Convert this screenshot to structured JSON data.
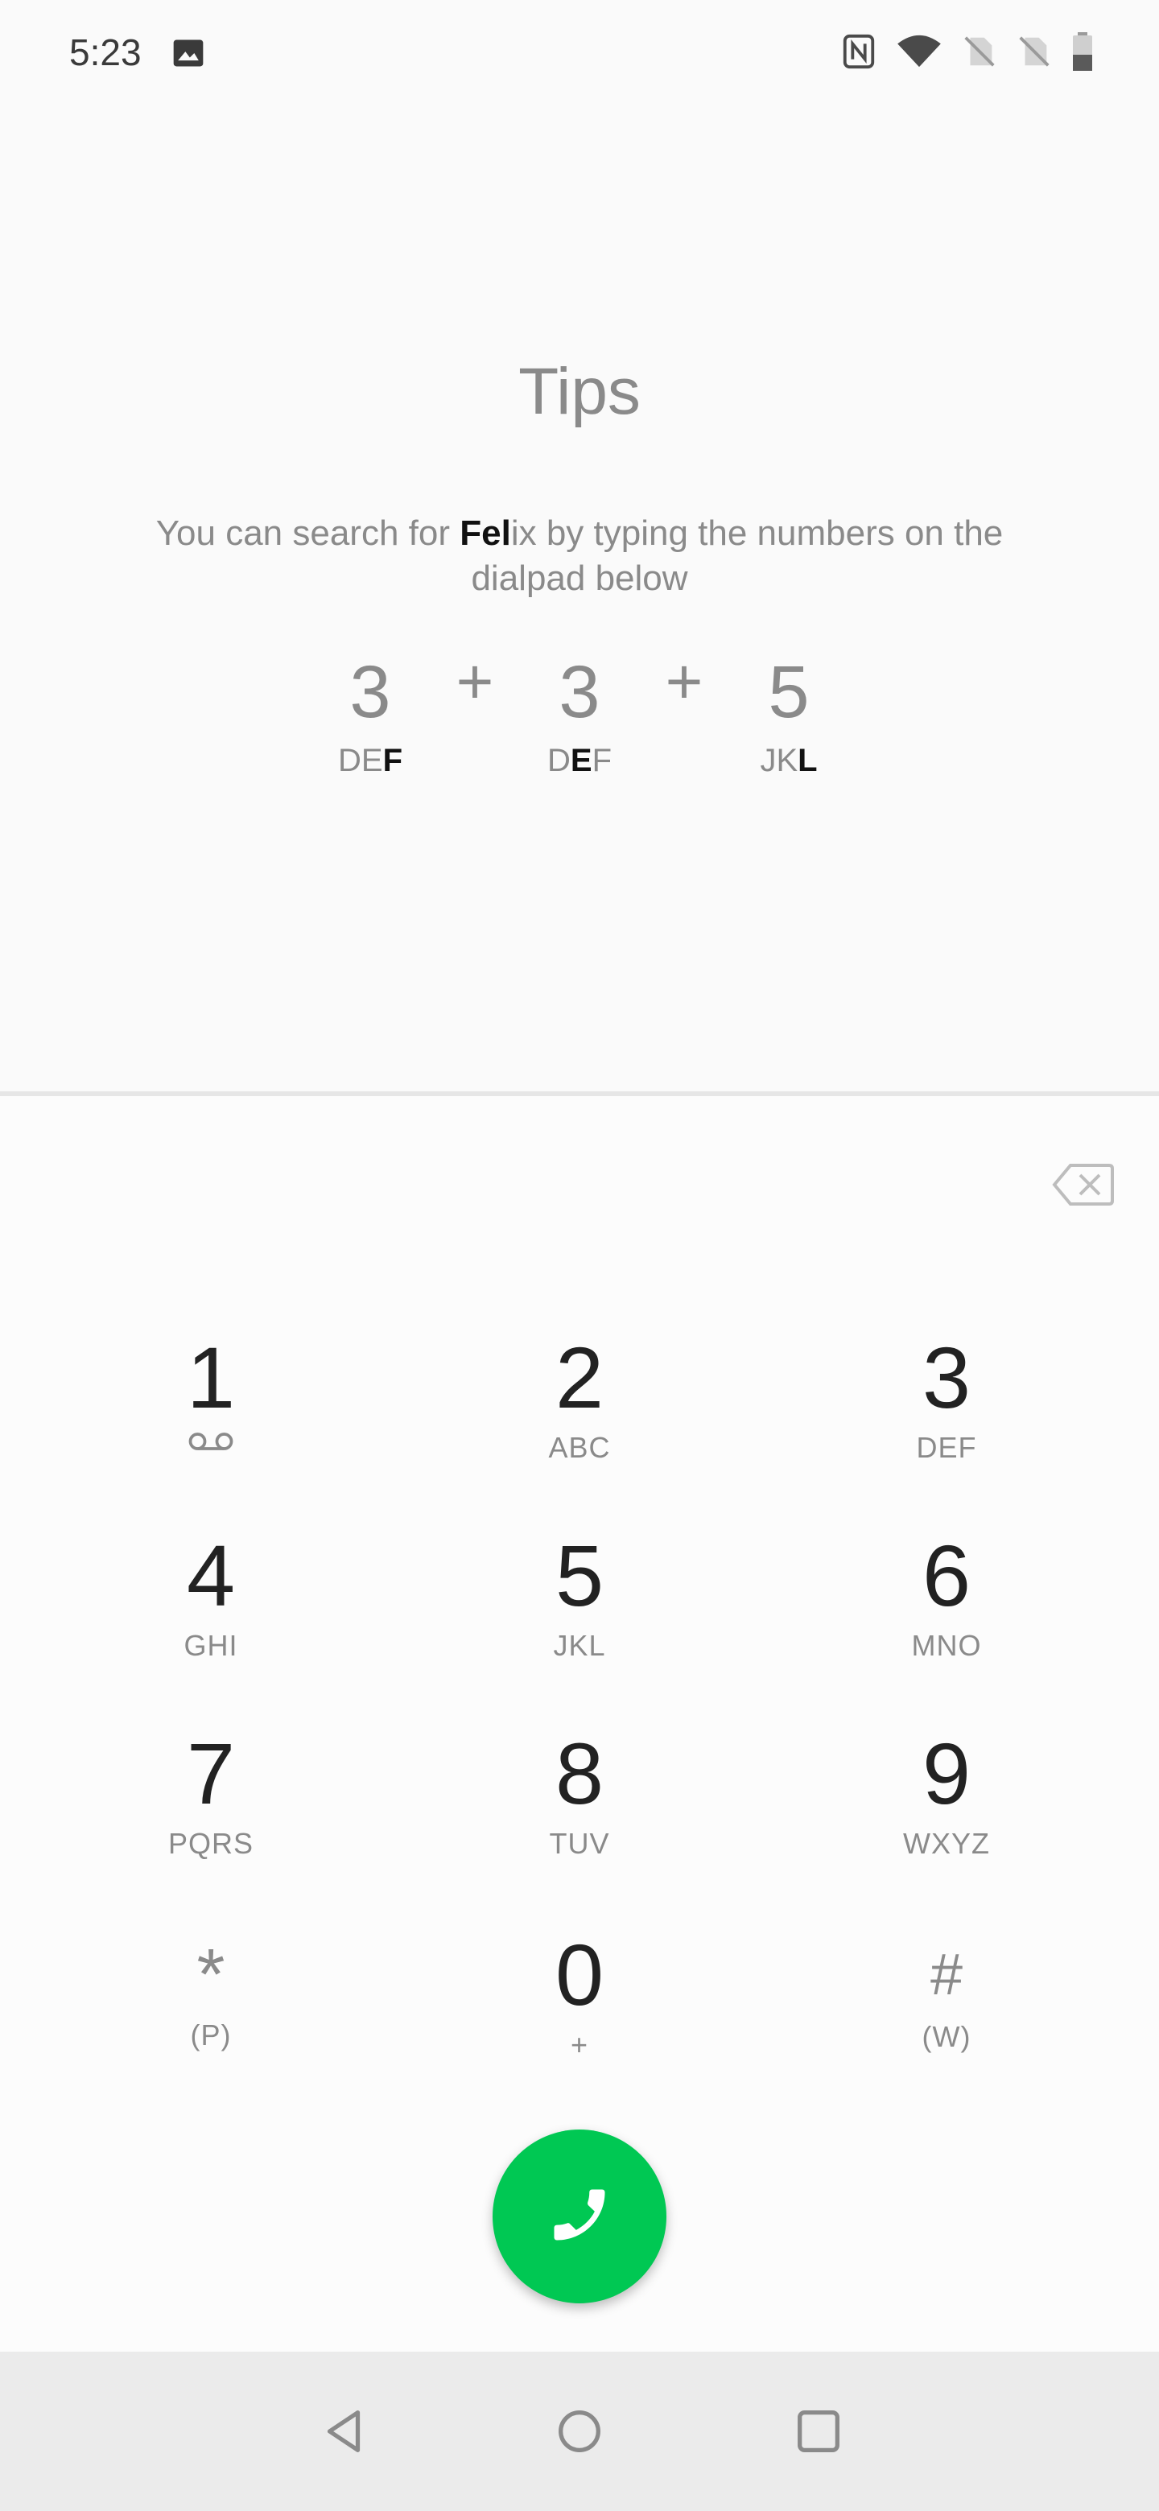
{
  "status_bar": {
    "time": "5:23",
    "left_icons": [
      "image-icon"
    ],
    "right_icons": [
      "nfc-icon",
      "wifi-icon",
      "no-sim-icon",
      "no-sim-icon",
      "battery-icon"
    ]
  },
  "tips": {
    "title": "Tips",
    "text_before": "You can search for ",
    "text_bold": "Fel",
    "text_after": "ix by typing the numbers on the dialpad below",
    "formula": [
      {
        "digit": "3",
        "letters_plain": "DE",
        "letters_bold": "F",
        "letters_tail": ""
      },
      {
        "digit": "3",
        "letters_plain": "D",
        "letters_bold": "E",
        "letters_tail": "F"
      },
      {
        "digit": "5",
        "letters_plain": "JK",
        "letters_bold": "L",
        "letters_tail": ""
      }
    ],
    "plus": "+"
  },
  "dialpad": {
    "keys": [
      {
        "digit": "1",
        "sub": ""
      },
      {
        "digit": "2",
        "sub": "ABC"
      },
      {
        "digit": "3",
        "sub": "DEF"
      },
      {
        "digit": "4",
        "sub": "GHI"
      },
      {
        "digit": "5",
        "sub": "JKL"
      },
      {
        "digit": "6",
        "sub": "MNO"
      },
      {
        "digit": "7",
        "sub": "PQRS"
      },
      {
        "digit": "8",
        "sub": "TUV"
      },
      {
        "digit": "9",
        "sub": "WXYZ"
      },
      {
        "digit": "*",
        "sub": "(P)"
      },
      {
        "digit": "0",
        "sub": "+"
      },
      {
        "digit": "#",
        "sub": "(W)"
      }
    ],
    "backspace_icon": "backspace-icon",
    "call_icon": "phone-icon",
    "call_color": "#00c853"
  },
  "navbar": {
    "icons": [
      "back-icon",
      "home-icon",
      "recents-icon"
    ]
  }
}
